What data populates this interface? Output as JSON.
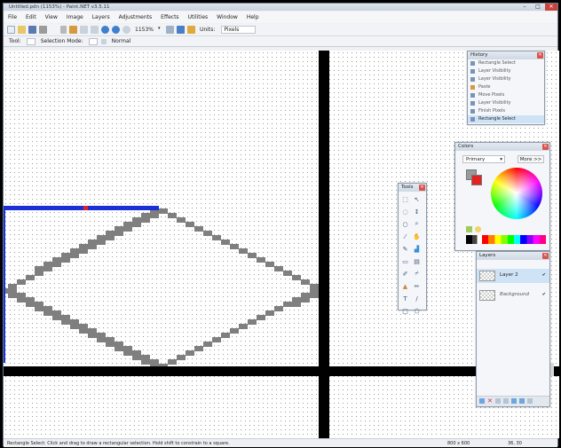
{
  "window": {
    "title": "Untitled.pdn (1153%) - Paint.NET v3.5.11",
    "controls": [
      "–",
      "□",
      "✕"
    ]
  },
  "menu": [
    "File",
    "Edit",
    "View",
    "Image",
    "Layers",
    "Adjustments",
    "Effects",
    "Utilities",
    "Window",
    "Help"
  ],
  "toolbar": {
    "zoom": "1153%",
    "units_label": "Units:",
    "units_value": "Pixels"
  },
  "toolbar2": {
    "tool_label": "Tool:",
    "selection_mode_label": "Selection Mode:",
    "blend_value": "Normal"
  },
  "history": {
    "title": "History",
    "items": [
      {
        "label": "Rectangle Select",
        "selected": false
      },
      {
        "label": "Layer Visibility",
        "selected": false
      },
      {
        "label": "Layer Visibility",
        "selected": false
      },
      {
        "label": "Paste",
        "selected": false
      },
      {
        "label": "Move Pixels",
        "selected": false
      },
      {
        "label": "Layer Visibility",
        "selected": false
      },
      {
        "label": "Finish Pixels",
        "selected": false
      },
      {
        "label": "Rectangle Select",
        "selected": true
      }
    ]
  },
  "colors": {
    "title": "Colors",
    "mode": "Primary",
    "more_button": "More >>",
    "primary": "#e52222",
    "secondary": "#ffffff"
  },
  "tools": {
    "title": "Tools",
    "icons": [
      "rectangle-select-icon",
      "move-icon",
      "lasso-icon",
      "move-selection-icon",
      "ellipse-select-icon",
      "zoom-icon",
      "magic-wand-icon",
      "pan-icon",
      "paintbrush-icon",
      "paint-bucket-icon",
      "eraser-icon",
      "gradient-icon",
      "pencil-icon",
      "color-picker-icon",
      "clone-stamp-icon",
      "recolor-icon",
      "text-icon",
      "line-icon",
      "shapes-icon",
      "freeform-icon"
    ]
  },
  "layers": {
    "title": "Layers",
    "items": [
      {
        "label": "Layer 2",
        "selected": true
      },
      {
        "label": "Background",
        "selected": false
      }
    ]
  },
  "status": {
    "hint": "Rectangle Select: Click and drag to draw a rectangular selection. Hold shift to constrain to a square.",
    "size": "800 x 600",
    "coords": "36, 30"
  },
  "colors_theme": {
    "selection_blue": "#1a2fd6",
    "diamond_gray": "#7f7f7f",
    "black_lines": "#000000"
  }
}
